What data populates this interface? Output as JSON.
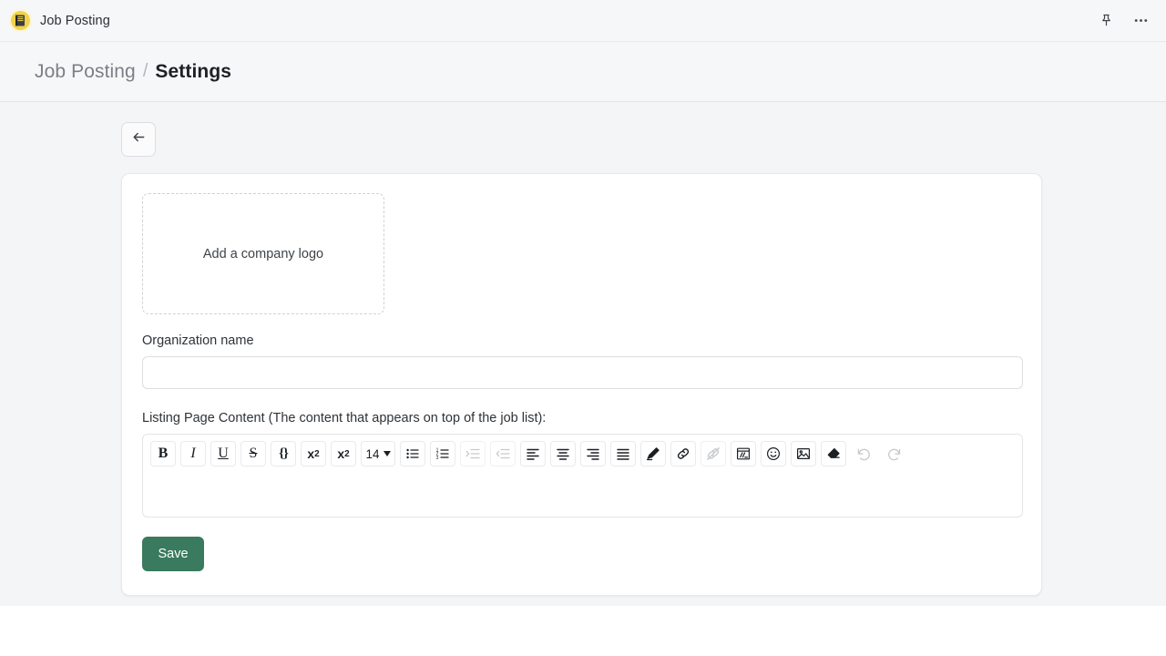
{
  "appbar": {
    "title": "Job Posting",
    "app_icon": "notebook-icon",
    "actions": [
      {
        "name": "pin-icon",
        "label": "Pin"
      },
      {
        "name": "more-options-icon",
        "label": "More options"
      }
    ]
  },
  "breadcrumb": {
    "parent": "Job Posting",
    "separator": "/",
    "current": "Settings"
  },
  "toolbar": {
    "back_label": "Back",
    "back_icon": "arrow-left-icon"
  },
  "form": {
    "logo_dropzone_label": "Add a company logo",
    "organization_label": "Organization name",
    "organization_value": "",
    "organization_placeholder": "",
    "editor_label": "Listing Page Content (The content that appears on top of the job list):",
    "editor_content": "",
    "save_label": "Save"
  },
  "editor_toolbar": {
    "font_size": "14",
    "items": [
      {
        "name": "bold-button",
        "glyph": "B",
        "enabled": true
      },
      {
        "name": "italic-button",
        "glyph": "I",
        "enabled": true
      },
      {
        "name": "underline-button",
        "glyph": "U",
        "enabled": true
      },
      {
        "name": "strikethrough-button",
        "glyph": "S",
        "enabled": true
      },
      {
        "name": "code-block-button",
        "glyph": "{}",
        "enabled": true
      },
      {
        "name": "superscript-button",
        "glyph": "x2",
        "enabled": true
      },
      {
        "name": "subscript-button",
        "glyph": "x2",
        "enabled": true
      },
      {
        "name": "font-size-dropdown",
        "glyph": "14",
        "enabled": true
      },
      {
        "name": "bulleted-list-button",
        "glyph": "ul",
        "enabled": true
      },
      {
        "name": "numbered-list-button",
        "glyph": "ol",
        "enabled": true
      },
      {
        "name": "indent-button",
        "glyph": "indent",
        "enabled": false
      },
      {
        "name": "outdent-button",
        "glyph": "outdent",
        "enabled": false
      },
      {
        "name": "align-left-button",
        "glyph": "alignl",
        "enabled": true
      },
      {
        "name": "align-center-button",
        "glyph": "alignc",
        "enabled": true
      },
      {
        "name": "align-right-button",
        "glyph": "alignr",
        "enabled": true
      },
      {
        "name": "align-justify-button",
        "glyph": "alignj",
        "enabled": true
      },
      {
        "name": "highlighter-pen-button",
        "glyph": "pen",
        "enabled": true
      },
      {
        "name": "insert-link-button",
        "glyph": "link",
        "enabled": true
      },
      {
        "name": "unlink-button",
        "glyph": "unlink",
        "enabled": false
      },
      {
        "name": "insert-table-button",
        "glyph": "table",
        "enabled": true
      },
      {
        "name": "emoji-button",
        "glyph": "emoji",
        "enabled": true
      },
      {
        "name": "insert-image-button",
        "glyph": "image",
        "enabled": true
      },
      {
        "name": "clear-format-button",
        "glyph": "eraser",
        "enabled": true
      },
      {
        "name": "undo-button",
        "glyph": "undo",
        "enabled": false
      },
      {
        "name": "redo-button",
        "glyph": "redo",
        "enabled": false
      }
    ]
  },
  "colors": {
    "accent_green": "#3a7a5e",
    "app_badge_yellow": "#f2d34b",
    "page_bg": "#f4f5f6",
    "bar_bg": "#f6f7f8",
    "card_bg": "#ffffff"
  }
}
